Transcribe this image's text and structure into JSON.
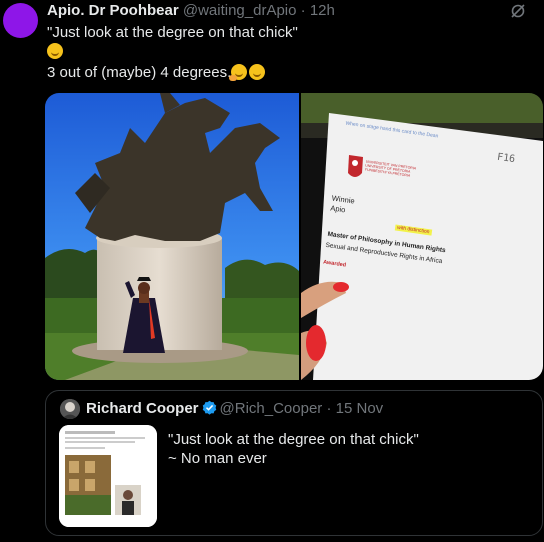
{
  "tweet": {
    "author_name": "Apio. Dr Poohbear",
    "author_handle": "@waiting_drApio",
    "separator": "·",
    "time": "12h",
    "line1": "\"Just look at the degree on that chick\"",
    "line3": "3 out of (maybe) 4 degrees.",
    "icons": [
      "smiling-face-icon",
      "hand-over-mouth-emoji-icon",
      "relieved-face-emoji-icon",
      "grok-icon"
    ],
    "avatar_color": "#8e16e8"
  },
  "card": {
    "header_text": "When on stage hand this card to the Dean",
    "code": "F16",
    "name_first": "Winnie",
    "name_last": "Apio",
    "distinction": "with distinction",
    "degree": "Master of Philosophy in Human Rights",
    "field": "Sexual and Reproductive Rights in Africa",
    "status": "Awarded",
    "univ_line1": "UNIVERSITEIT VAN PRETORIA",
    "univ_line2": "UNIVERSITY OF PRETORIA",
    "univ_line3": "YUNIBESITHI YA PRETORIA"
  },
  "quote": {
    "author_name": "Richard Cooper",
    "author_handle": "@Rich_Cooper",
    "separator": "·",
    "date": "15 Nov",
    "line1": "\"Just look at the degree on that chick\"",
    "line2": "~ No man ever",
    "verified_color": "#1d9bf0"
  },
  "colors": {
    "background": "#000000",
    "text": "#e7e9ea",
    "muted": "#71767b",
    "border": "#2f3336"
  }
}
